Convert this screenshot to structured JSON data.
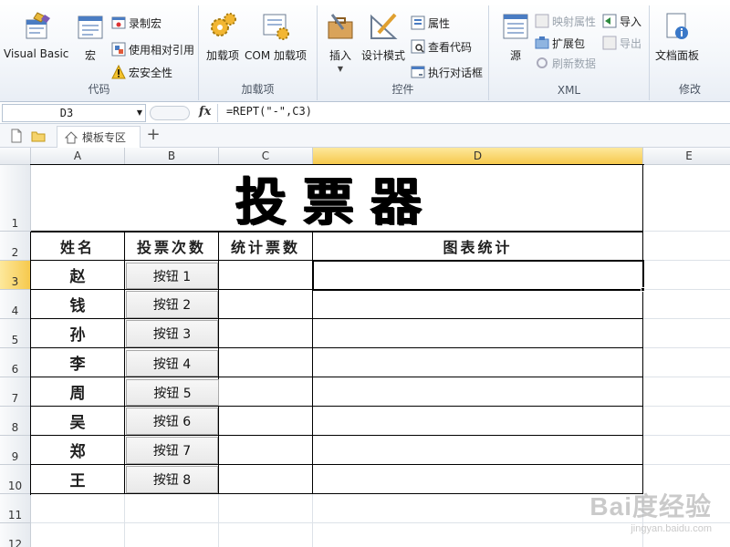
{
  "ribbon": {
    "groups": [
      {
        "label": "代码"
      },
      {
        "label": "加载项"
      },
      {
        "label": "控件"
      },
      {
        "label": "XML"
      },
      {
        "label": "修改"
      }
    ],
    "code": {
      "visual_basic": "Visual Basic",
      "macros": "宏",
      "record_macro": "录制宏",
      "use_relative": "使用相对引用",
      "macro_security": "宏安全性"
    },
    "addins": {
      "addins": "加载项",
      "com_addins": "COM 加载项"
    },
    "controls": {
      "insert": "插入",
      "design_mode": "设计模式",
      "properties": "属性",
      "view_code": "查看代码",
      "run_dialog": "执行对话框"
    },
    "xml": {
      "source": "源",
      "map_properties": "映射属性",
      "expansion_packs": "扩展包",
      "refresh_data": "刷新数据",
      "import": "导入",
      "export": "导出"
    },
    "modify": {
      "document_panel": "文档面板"
    }
  },
  "formula_bar": {
    "name_box": "D3",
    "formula": "=REPT(\"-\",C3)",
    "fx": "fx"
  },
  "tabs": {
    "sheet_name": "模板专区",
    "add": "+"
  },
  "columns": [
    "A",
    "B",
    "C",
    "D",
    "E"
  ],
  "rows": [
    "1",
    "2",
    "3",
    "4",
    "5",
    "6",
    "7",
    "8",
    "9",
    "10",
    "11",
    "12"
  ],
  "active_cell": {
    "col": "D",
    "row": "3"
  },
  "sheet": {
    "title": "投票器",
    "headers": [
      "姓名",
      "投票次数",
      "统计票数",
      "图表统计"
    ],
    "entries": [
      {
        "name": "赵",
        "button": "按钮 1",
        "count": "",
        "chart": ""
      },
      {
        "name": "钱",
        "button": "按钮 2",
        "count": "",
        "chart": ""
      },
      {
        "name": "孙",
        "button": "按钮 3",
        "count": "",
        "chart": ""
      },
      {
        "name": "李",
        "button": "按钮 4",
        "count": "",
        "chart": ""
      },
      {
        "name": "周",
        "button": "按钮 5",
        "count": "",
        "chart": ""
      },
      {
        "name": "吴",
        "button": "按钮 6",
        "count": "",
        "chart": ""
      },
      {
        "name": "郑",
        "button": "按钮 7",
        "count": "",
        "chart": ""
      },
      {
        "name": "王",
        "button": "按钮 8",
        "count": "",
        "chart": ""
      }
    ]
  },
  "watermark": {
    "main": "Bai度经验",
    "sub": "jingyan.baidu.com"
  },
  "colors": {
    "active_header": "#f6c94d",
    "grid_line": "#dde2e8",
    "ribbon_bg": "#f3f6fa"
  }
}
